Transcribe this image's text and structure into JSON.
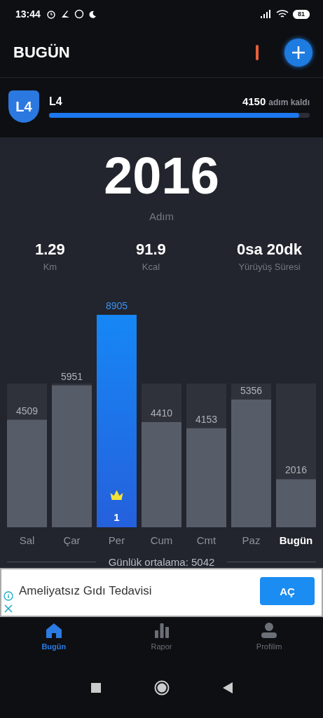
{
  "status_bar": {
    "time": "13:44",
    "battery": "81"
  },
  "header": {
    "title": "BUGÜN"
  },
  "level_card": {
    "badge": "L4",
    "name": "L4",
    "remaining": "4150",
    "remaining_unit": "adım kaldı",
    "level": 0.96
  },
  "today": {
    "steps": "2016",
    "steps_label": "Adım"
  },
  "stats": [
    {
      "value": "1.29",
      "label": "Km"
    },
    {
      "value": "91.9",
      "label": "Kcal"
    },
    {
      "value": "0sa 20dk",
      "label": "Yürüyüş Süresi"
    }
  ],
  "chart": {
    "best_rank": "1",
    "chart_data": {
      "type": "bar",
      "categories": [
        "Sal",
        "Çar",
        "Per",
        "Cum",
        "Cmt",
        "Paz",
        "Bugün"
      ],
      "values": [
        4509,
        5951,
        8905,
        4410,
        4153,
        5356,
        2016
      ],
      "data_labels": true
    },
    "average": "Günlük ortalama: 5042"
  },
  "ad": {
    "text": "Ameliyatsız Gıdı Tedavisi",
    "button": "AÇ"
  },
  "bottom_nav": [
    {
      "label": "Bugün",
      "kind": "home",
      "selected": true
    },
    {
      "label": "Rapor",
      "kind": "bars",
      "selected": false
    },
    {
      "label": "Profilim",
      "kind": "person",
      "selected": false
    }
  ]
}
